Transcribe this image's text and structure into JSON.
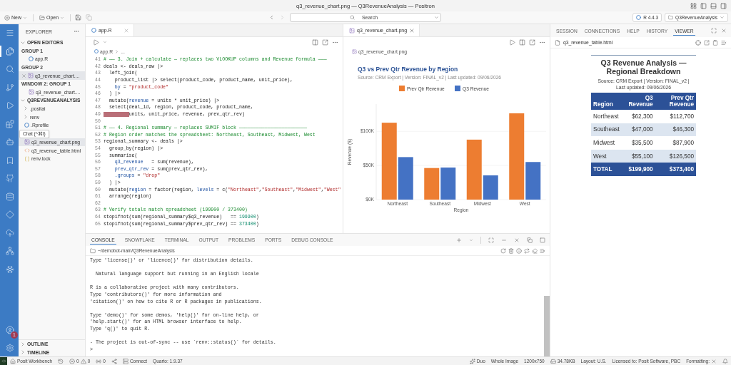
{
  "window": {
    "title": "q3_revenue_chart.png — Q3RevenueAnalysis — Positron"
  },
  "toolbar": {
    "new": "New",
    "open": "Open",
    "search": {
      "placeholder": "Search"
    },
    "r_version": "R 4.4.3",
    "project": "Q3RevenueAnalysis"
  },
  "activity_bar": {
    "items": [
      {
        "kind": "menu",
        "selected": false
      },
      {
        "kind": "files",
        "selected": true
      },
      {
        "kind": "search",
        "selected": false
      },
      {
        "kind": "source-control",
        "selected": false
      },
      {
        "kind": "run",
        "selected": false
      },
      {
        "kind": "extensions",
        "selected": false
      },
      {
        "kind": "assistant",
        "selected": false
      },
      {
        "kind": "bookmark",
        "selected": false
      },
      {
        "kind": "github",
        "selected": false
      },
      {
        "kind": "database",
        "selected": false
      },
      {
        "kind": "diamond",
        "selected": false
      },
      {
        "kind": "publish",
        "selected": false
      },
      {
        "kind": "connections",
        "selected": false
      },
      {
        "kind": "snowflake",
        "selected": false
      }
    ],
    "bottom": [
      {
        "kind": "account",
        "badge": "1"
      },
      {
        "kind": "settings"
      }
    ]
  },
  "explorer": {
    "title": "EXPLORER",
    "open_editors": {
      "title": "OPEN EDITORS",
      "expanded": true,
      "groups": [
        {
          "title": "GROUP 1",
          "files": [
            {
              "name": "app.R",
              "kind": "r",
              "selected": false
            }
          ]
        },
        {
          "title": "GROUP 2",
          "files": [
            {
              "name": "q3_revenue_chart....",
              "kind": "image",
              "selected": true
            }
          ]
        },
        {
          "title": "WINDOW 2: GROUP 1",
          "files": [
            {
              "name": "q3_revenue_chart....",
              "kind": "image",
              "selected": false
            }
          ]
        }
      ]
    },
    "project": {
      "title": "Q3REVENUEANALYSIS",
      "expanded": true,
      "items": [
        {
          "name": ".positai",
          "kind": "folder",
          "selected": false
        },
        {
          "name": "renv",
          "kind": "folder",
          "selected": false
        },
        {
          "name": ".Rprofile",
          "kind": "r",
          "selected": false,
          "tooltip": "Chat (^⌘I)"
        },
        {
          "name": "q3_revenue_chart.png",
          "kind": "image",
          "selected": true
        },
        {
          "name": "q3_revenue_table.html",
          "kind": "html",
          "selected": false
        },
        {
          "name": "renv.lock",
          "kind": "json",
          "selected": false
        }
      ]
    },
    "outline": {
      "title": "OUTLINE",
      "expanded": false
    },
    "timeline": {
      "title": "TIMELINE",
      "expanded": false
    }
  },
  "editor": {
    "tab": {
      "label": "app.R",
      "selected": true
    },
    "breadcrumb": "app.R",
    "breadcrumb_more": "...",
    "lines": [
      {
        "number": "41",
        "kind": "comment",
        "text": "# —— 3. Join + calculate — replaces two VLOOKUP columns and Revenue formula ———"
      },
      {
        "number": "42",
        "kind": "code",
        "text": "deals <- deals_raw |>"
      },
      {
        "number": "43",
        "kind": "code",
        "text": "  left_join("
      },
      {
        "number": "44",
        "kind": "code",
        "text": "    product_list |> select(product_code, product_name, unit_price),"
      },
      {
        "number": "45",
        "kind": "code",
        "text": "    by = \"product_code\""
      },
      {
        "number": "46",
        "kind": "code",
        "text": "  ) |>"
      },
      {
        "number": "47",
        "kind": "code",
        "text": "  mutate(revenue = units * unit_price) |>"
      },
      {
        "number": "48",
        "kind": "code",
        "text": "  select(deal_id, region, product_code, product_name,"
      },
      {
        "number": "49",
        "kind": "flagged-indent",
        "text": "         units, unit_price, revenue, prev_qtr_rev)"
      },
      {
        "number": "50",
        "kind": "code"
      },
      {
        "number": "51",
        "kind": "comment",
        "text": "# —— 4. Regional summary — replaces SUMIF block ————————————————————————"
      },
      {
        "number": "52",
        "kind": "comment",
        "text": "# Region order matches the spreadsheet: Northeast, Southeast, Midwest, West"
      },
      {
        "number": "53",
        "kind": "code",
        "text": "regional_summary <- deals |>"
      },
      {
        "number": "54",
        "kind": "code",
        "text": "  group_by(region) |>"
      },
      {
        "number": "55",
        "kind": "code",
        "text": "  summarise("
      },
      {
        "number": "56",
        "kind": "code",
        "text": "    q3_revenue   = sum(revenue),"
      },
      {
        "number": "57",
        "kind": "code",
        "text": "    prev_qtr_rev = sum(prev_qtr_rev),"
      },
      {
        "number": "58",
        "kind": "code",
        "text": "    .groups = \"drop\""
      },
      {
        "number": "59",
        "kind": "code",
        "text": "  ) |>"
      },
      {
        "number": "60",
        "kind": "code",
        "text": "  mutate(region = factor(region, levels = c(\"Northeast\",\"Southeast\",\"Midwest\",\"West\""
      },
      {
        "number": "61",
        "kind": "code",
        "text": "  arrange(region)"
      },
      {
        "number": "62",
        "kind": "code"
      },
      {
        "number": "63",
        "kind": "comment",
        "text": "# Verify totals match spreadsheet (199900 / 373400)"
      },
      {
        "number": "64",
        "kind": "code",
        "text": "stopifnot(sum(regional_summary$q3_revenue)   == 199900)"
      },
      {
        "number": "65",
        "kind": "code",
        "text": "stopifnot(sum(regional_summary$prev_qtr_rev) == 373400)"
      }
    ]
  },
  "image_editor": {
    "tab": {
      "label": "q3_revenue_chart.png",
      "selected": true
    },
    "breadcrumb": "q3_revenue_chart.png",
    "subtitle": "Source: CRM Export | Version: FINAL_v2 | Last updated: 09/06/2026",
    "chart_data": {
      "type": "bar",
      "title": "Q3 vs Prev Qtr Revenue by Region",
      "xlabel": "Region",
      "ylabel": "Revenue ($)",
      "categories": [
        "Northeast",
        "Southeast",
        "Midwest",
        "West"
      ],
      "series": [
        {
          "name": "Prev Qtr Revenue",
          "color": "#ed7d31",
          "values": [
            112700,
            46300,
            87900,
            126500
          ]
        },
        {
          "name": "Q3 Revenue",
          "color": "#4472c4",
          "values": [
            62300,
            47000,
            35500,
            55100
          ]
        }
      ],
      "legend": true,
      "ylim": [
        0,
        140000
      ],
      "yticks": [
        {
          "value": 0,
          "label": "$0K"
        },
        {
          "value": 50000,
          "label": "$50K"
        },
        {
          "value": 100000,
          "label": "$100K"
        }
      ]
    }
  },
  "panel": {
    "tabs": [
      {
        "label": "CONSOLE",
        "selected": true
      },
      {
        "label": "SNOWFLAKE",
        "selected": false
      },
      {
        "label": "TERMINAL",
        "selected": false
      },
      {
        "label": "OUTPUT",
        "selected": false
      },
      {
        "label": "PROBLEMS",
        "selected": false
      },
      {
        "label": "PORTS",
        "selected": false
      },
      {
        "label": "DEBUG CONSOLE",
        "selected": false
      }
    ],
    "path": "~/demobot-main/Q3RevenueAnalysis",
    "console_blocks": [
      [
        "Type 'license()' or 'licence()' for distribution details."
      ],
      [
        "  Natural language support but running in an English locale"
      ],
      [
        "R is a collaborative project with many contributors.",
        "Type 'contributors()' for more information and",
        "'citation()' on how to cite R or R packages in publications."
      ],
      [
        "Type 'demo()' for some demos, 'help()' for on-line help, or",
        "'help.start()' for an HTML browser interface to help.",
        "Type 'q()' to quit R."
      ],
      [
        "- The project is out-of-sync -- use `renv::status()` for details."
      ]
    ],
    "prompt": ">"
  },
  "right_panel": {
    "tabs": [
      {
        "label": "SESSION",
        "selected": false
      },
      {
        "label": "CONNECTIONS",
        "selected": false
      },
      {
        "label": "HELP",
        "selected": false
      },
      {
        "label": "HISTORY",
        "selected": false
      },
      {
        "label": "VIEWER",
        "selected": true
      }
    ],
    "file": "q3_revenue_table.html",
    "table": {
      "title": "Q3 Revenue Analysis — Regional Breakdown",
      "subtitle": "Source: CRM Export | Version: FINAL_v2 | Last updated: 09/06/2026",
      "columns": [
        "Region",
        "Q3 Revenue",
        "Prev Qtr Revenue"
      ],
      "rows": [
        [
          "Northeast",
          "$62,300",
          "$112,700"
        ],
        [
          "Southeast",
          "$47,000",
          "$46,300"
        ],
        [
          "Midwest",
          "$35,500",
          "$87,900"
        ],
        [
          "West",
          "$55,100",
          "$126,500"
        ]
      ],
      "total": [
        "TOTAL",
        "$199,900",
        "$373,400"
      ]
    }
  },
  "status_bar": {
    "left": [
      {
        "kind": "remote"
      },
      {
        "kind": "workbench",
        "text": "Posit Workbench"
      },
      {
        "kind": "history"
      },
      {
        "kind": "problems",
        "errors": "0",
        "warnings": "0"
      },
      {
        "kind": "ports",
        "text": "0"
      },
      {
        "kind": "share"
      },
      {
        "kind": "connect",
        "text": "Connect"
      },
      {
        "kind": "text",
        "text": "Quarto: 1.9.37"
      }
    ],
    "right": [
      {
        "kind": "duo",
        "text": "Duo"
      },
      {
        "kind": "text",
        "text": "Whole Image"
      },
      {
        "kind": "text",
        "text": "1200x750"
      },
      {
        "kind": "disk",
        "text": "34.78KB"
      },
      {
        "kind": "text",
        "text": "Layout: U.S."
      },
      {
        "kind": "text",
        "text": "Licensed to: Posit Software, PBC"
      },
      {
        "kind": "formatting",
        "text": "Formatting:"
      },
      {
        "kind": "bell"
      }
    ]
  }
}
